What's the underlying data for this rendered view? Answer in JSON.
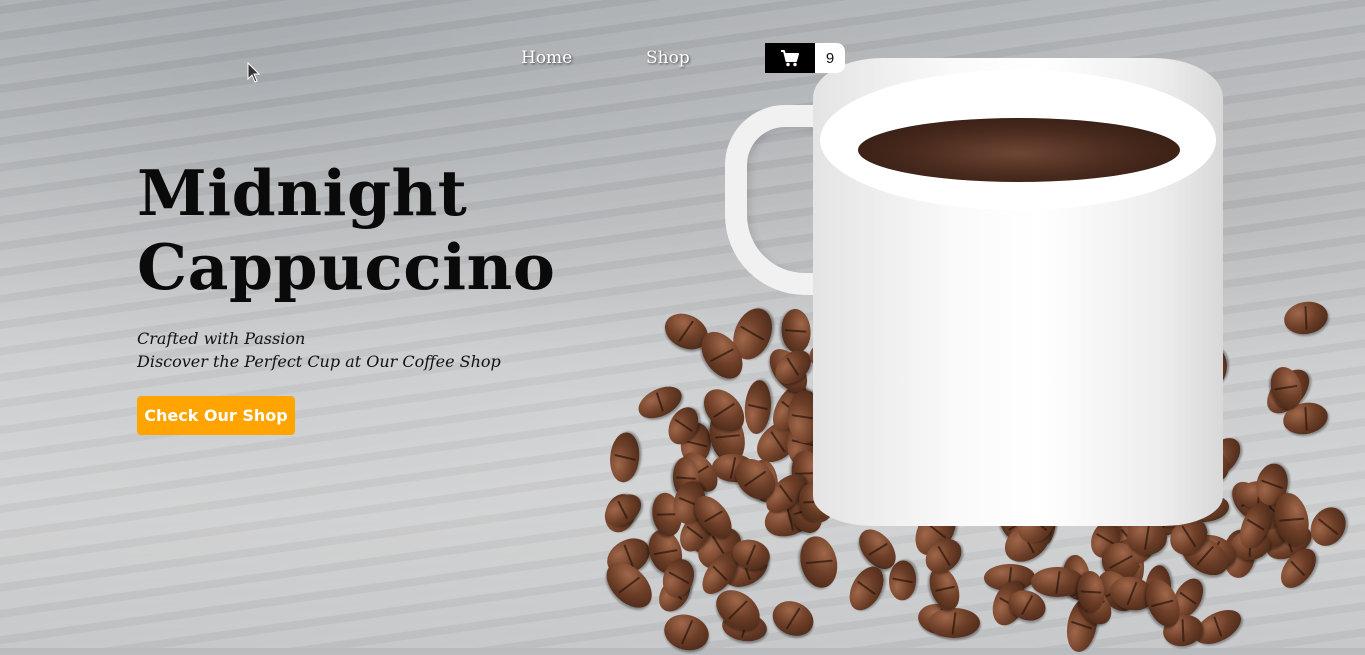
{
  "nav": {
    "links": [
      {
        "label": "Home"
      },
      {
        "label": "Shop"
      }
    ],
    "cart": {
      "icon": "cart-icon",
      "count": "9"
    }
  },
  "hero": {
    "title_line1": "Midnight",
    "title_line2": "Cappuccino",
    "subtitle_line1": "Crafted with Passion",
    "subtitle_line2": "Discover the Perfect Cup at Our Coffee Shop",
    "cta_label": "Check Our Shop"
  },
  "colors": {
    "accent": "#ffa400",
    "cart_bg": "#000000",
    "text_dark": "#0a0a0a",
    "nav_text": "#ffffff"
  }
}
